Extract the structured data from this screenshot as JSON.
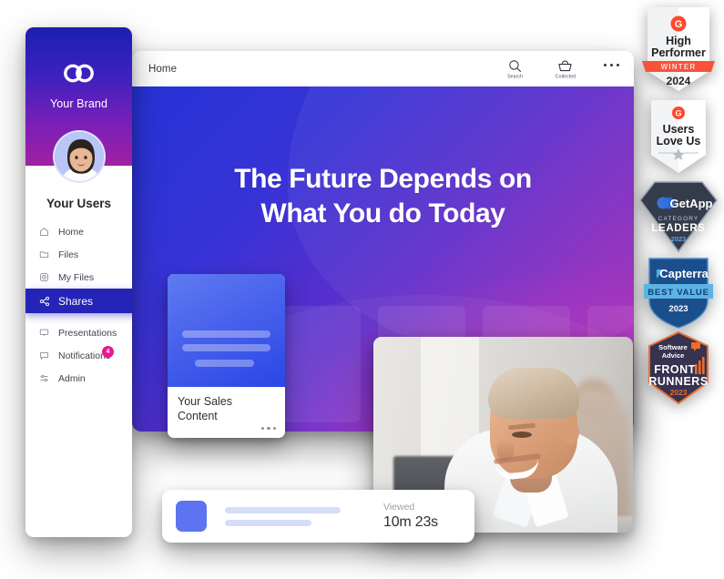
{
  "app_window": {
    "topbar": {
      "title": "Home",
      "actions": [
        {
          "icon": "search-icon",
          "label": "Search"
        },
        {
          "icon": "collected-basket-icon",
          "label": "Collected"
        }
      ],
      "overflow_label": "More options"
    },
    "hero": {
      "title_line1": "The Future Depends on",
      "title_line2": "What You do Today",
      "gradient_from": "#2633d8",
      "gradient_to": "#a62bb0"
    }
  },
  "sales_card": {
    "title_line1": "Your Sales",
    "title_line2": "Content",
    "menu_label": "More",
    "thumb_color": "#4a63ec"
  },
  "sidebar": {
    "brand": "Your Brand",
    "logo_icon": "infinity-loop-icon",
    "user_name": "Your Users",
    "avatar_icon": "avatar",
    "items": [
      {
        "label": "Home",
        "icon": "home-icon",
        "active": false,
        "badge": ""
      },
      {
        "label": "Files",
        "icon": "folder-icon",
        "active": false,
        "badge": ""
      },
      {
        "label": "My Files",
        "icon": "my-files-icon",
        "active": false,
        "badge": ""
      },
      {
        "label": "Shares",
        "icon": "share-nodes-icon",
        "active": true,
        "badge": ""
      },
      {
        "label": "Presentations",
        "icon": "presentation-icon",
        "active": false,
        "badge": ""
      },
      {
        "label": "Notifications",
        "icon": "chat-bubble-icon",
        "active": false,
        "badge": "4"
      },
      {
        "label": "Admin",
        "icon": "sliders-icon",
        "active": false,
        "badge": ""
      }
    ],
    "badge_color": "#e8188f",
    "active_color": "#2424b8"
  },
  "stat_bar": {
    "label": "Viewed",
    "value": "10m 23s",
    "swatch_color": "#5d73ef"
  },
  "video_panel": {
    "alt": "smiling man in white shirt in an office"
  },
  "badges": [
    {
      "id": "g2-high-performer",
      "source": "G2",
      "line1": "High",
      "line2": "Performer",
      "ribbon": "WINTER",
      "year": "2024",
      "ribbon_color": "#f5543b",
      "body_color": "#ffffff"
    },
    {
      "id": "g2-users-love-us",
      "source": "G2",
      "line1": "Users",
      "line2": "Love Us",
      "ribbon": "",
      "year": "",
      "ribbon_color": "",
      "body_color": "#ffffff"
    },
    {
      "id": "getapp-category-leaders",
      "source": "GetApp",
      "line1": "CATEGORY",
      "line2": "LEADERS",
      "ribbon": "",
      "year": "2023",
      "ribbon_color": "",
      "body_color": "#343b4a"
    },
    {
      "id": "capterra-best-value",
      "source": "Capterra",
      "line1": "BEST VALUE",
      "line2": "",
      "ribbon": "BEST VALUE",
      "year": "2023",
      "ribbon_color": "#5cb3e4",
      "body_color": "#1b4f8c"
    },
    {
      "id": "software-advice-front-runners",
      "source": "Software Advice",
      "line1": "FRONT",
      "line2": "RUNNERS",
      "ribbon": "",
      "year": "2023",
      "ribbon_color": "",
      "body_color": "#36324f"
    }
  ]
}
